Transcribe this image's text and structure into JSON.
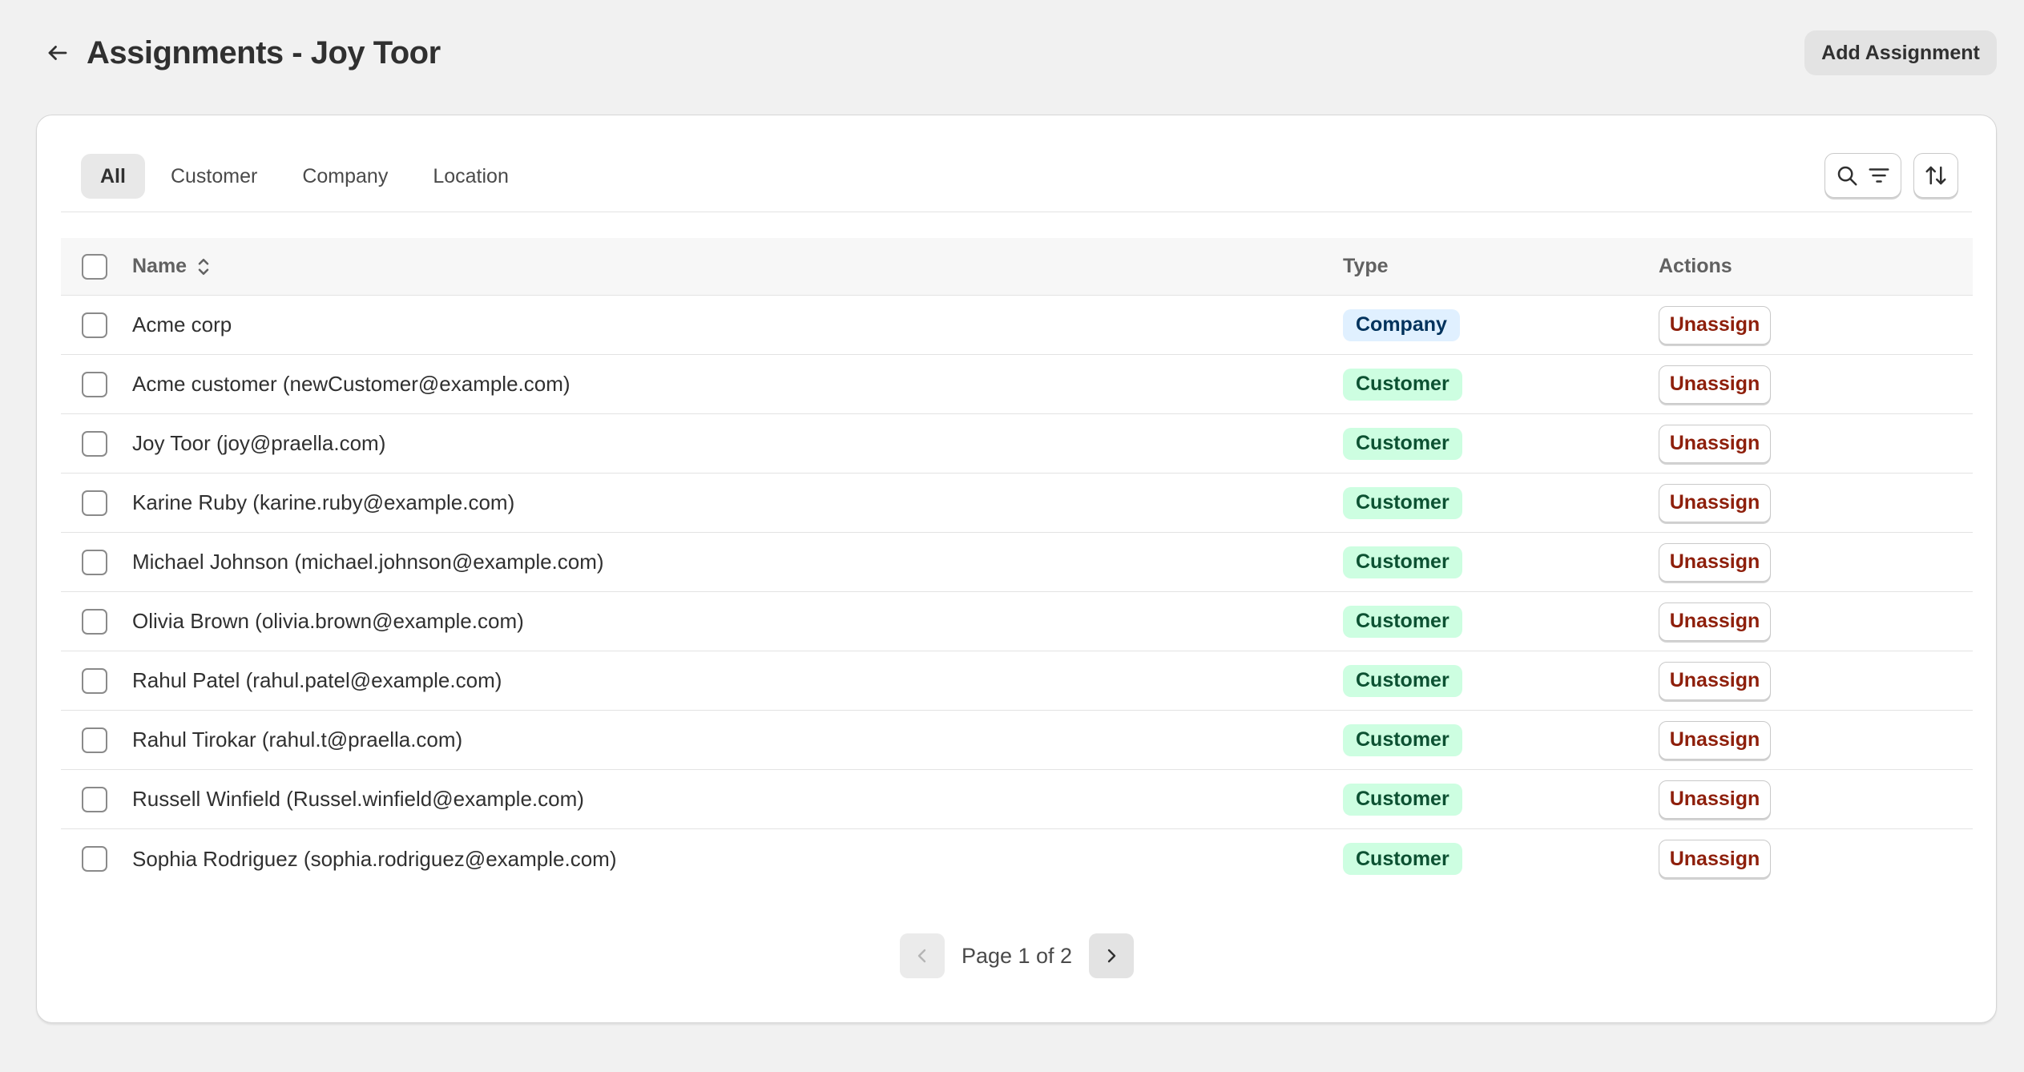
{
  "header": {
    "title": "Assignments - Joy Toor",
    "add_button": "Add Assignment"
  },
  "tabs": [
    {
      "label": "All",
      "active": true
    },
    {
      "label": "Customer",
      "active": false
    },
    {
      "label": "Company",
      "active": false
    },
    {
      "label": "Location",
      "active": false
    }
  ],
  "table": {
    "columns": {
      "name": "Name",
      "type": "Type",
      "actions": "Actions"
    },
    "rows": [
      {
        "name": "Acme corp",
        "type": "Company",
        "action": "Unassign"
      },
      {
        "name": "Acme customer (newCustomer@example.com)",
        "type": "Customer",
        "action": "Unassign"
      },
      {
        "name": "Joy Toor (joy@praella.com)",
        "type": "Customer",
        "action": "Unassign"
      },
      {
        "name": "Karine Ruby (karine.ruby@example.com)",
        "type": "Customer",
        "action": "Unassign"
      },
      {
        "name": "Michael Johnson (michael.johnson@example.com)",
        "type": "Customer",
        "action": "Unassign"
      },
      {
        "name": "Olivia Brown (olivia.brown@example.com)",
        "type": "Customer",
        "action": "Unassign"
      },
      {
        "name": "Rahul Patel (rahul.patel@example.com)",
        "type": "Customer",
        "action": "Unassign"
      },
      {
        "name": "Rahul Tirokar (rahul.t@praella.com)",
        "type": "Customer",
        "action": "Unassign"
      },
      {
        "name": "Russell Winfield (Russel.winfield@example.com)",
        "type": "Customer",
        "action": "Unassign"
      },
      {
        "name": "Sophia Rodriguez (sophia.rodriguez@example.com)",
        "type": "Customer",
        "action": "Unassign"
      }
    ]
  },
  "pagination": {
    "label": "Page 1 of 2",
    "prev_enabled": false,
    "next_enabled": true
  },
  "icons": {
    "back": "arrow-left-icon",
    "search": "search-icon",
    "filter": "filter-icon",
    "sort": "sort-icon",
    "sort_column": "chevron-up-down-icon",
    "prev": "chevron-left-icon",
    "next": "chevron-right-icon"
  },
  "colors": {
    "page_bg": "#f1f1f1",
    "company_badge_bg": "#e0f0ff",
    "customer_badge_bg": "#cdfee1",
    "unassign_text": "#8e1f0b"
  }
}
